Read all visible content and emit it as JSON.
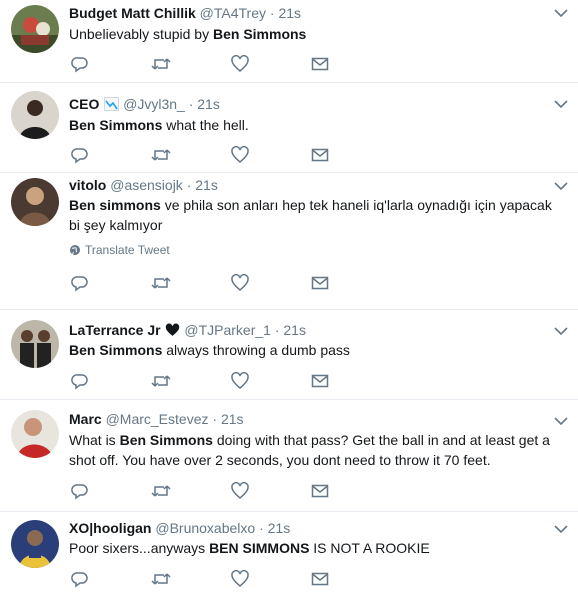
{
  "tweets": [
    {
      "name": "Budget Matt Chillik",
      "handle": "@TA4Trey",
      "dot": "·",
      "time": "21s",
      "text": [
        {
          "t": "Unbelievably stupid by ",
          "b": false
        },
        {
          "t": "Ben Simmons",
          "b": true
        }
      ]
    },
    {
      "name": "CEO",
      "handle": "@Jvyl3n_",
      "dot": "·",
      "time": "21s",
      "text": [
        {
          "t": "Ben Simmons",
          "b": true
        },
        {
          "t": " what the hell.",
          "b": false
        }
      ]
    },
    {
      "name": "vitolo",
      "handle": "@asensiojk",
      "dot": "·",
      "time": "21s",
      "text": [
        {
          "t": "Ben simmons",
          "b": true
        },
        {
          "t": " ve phila son anları hep tek haneli iq'larla oynadığı için yapacak bi şey kalmıyor",
          "b": false
        }
      ],
      "translate_label": "Translate Tweet"
    },
    {
      "name": "LaTerrance Jr",
      "handle": "@TJParker_1",
      "dot": "·",
      "time": "21s",
      "text": [
        {
          "t": "Ben Simmons",
          "b": true
        },
        {
          "t": " always throwing a dumb pass",
          "b": false
        }
      ]
    },
    {
      "name": "Marc",
      "handle": "@Marc_Estevez",
      "dot": "·",
      "time": "21s",
      "text": [
        {
          "t": "What is ",
          "b": false
        },
        {
          "t": "Ben Simmons",
          "b": true
        },
        {
          "t": " doing with that pass? Get the ball in and at least get a shot off. You have over 2 seconds, you dont need to throw it 70 feet.",
          "b": false
        }
      ]
    },
    {
      "name": "XO|hooligan",
      "handle": "@Brunoxabelxo",
      "dot": "·",
      "time": "21s",
      "text": [
        {
          "t": "Poor sixers...anyways ",
          "b": false
        },
        {
          "t": "BEN SIMMONS",
          "b": true
        },
        {
          "t": " IS NOT A ROOKIE",
          "b": false
        }
      ]
    }
  ],
  "icons": {
    "reply": "reply-icon",
    "retweet": "retweet-icon",
    "like": "heart-icon",
    "message": "envelope-icon",
    "caret": "chevron-down-icon",
    "globe": "globe-icon"
  },
  "colors": {
    "text": "#14171a",
    "muted": "#657786",
    "border": "#e6ecf0",
    "link_blue": "#1da1f2"
  }
}
